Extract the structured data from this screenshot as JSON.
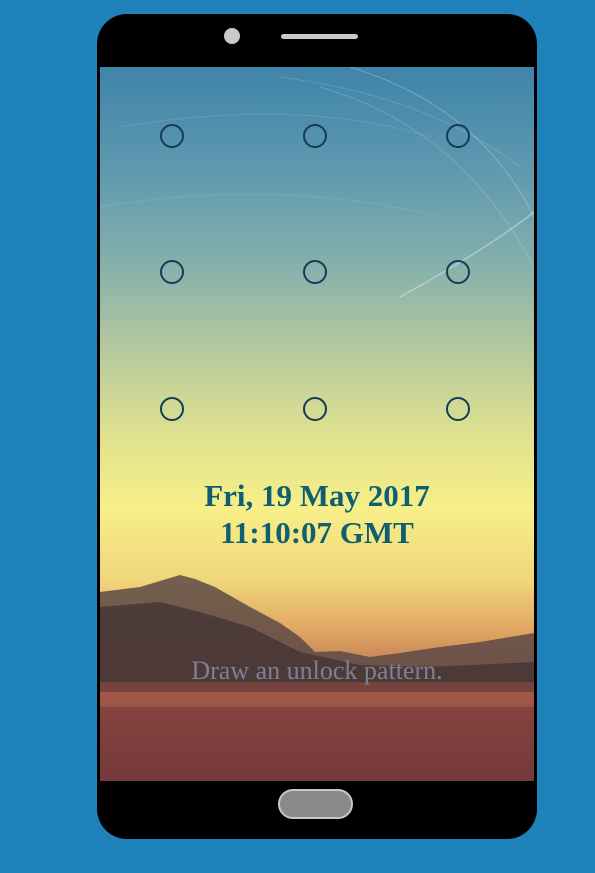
{
  "lockscreen": {
    "date": "Fri, 19 May 2017",
    "time": "11:10:07 GMT",
    "prompt": "Draw an unlock pattern.",
    "pattern_dots": [
      {
        "id": 1
      },
      {
        "id": 2
      },
      {
        "id": 3
      },
      {
        "id": 4
      },
      {
        "id": 5
      },
      {
        "id": 6
      },
      {
        "id": 7
      },
      {
        "id": 8
      },
      {
        "id": 9
      }
    ]
  },
  "colors": {
    "page_background": "#1f82bb",
    "device_body": "#000000",
    "text_datetime": "#0f5e71",
    "text_prompt": "#7d8195",
    "dot_outline": "#123b55"
  },
  "icons": {
    "camera": "camera-icon",
    "speaker": "speaker-icon",
    "home": "home-button"
  }
}
